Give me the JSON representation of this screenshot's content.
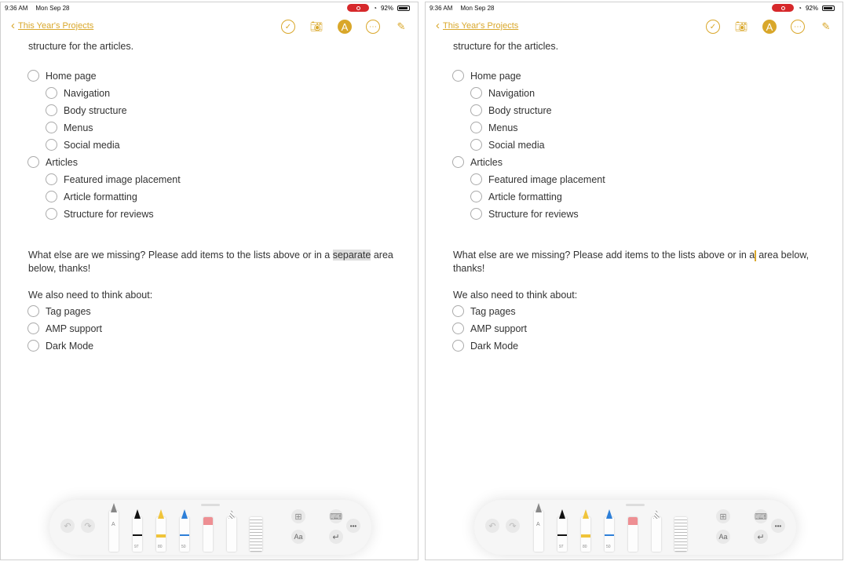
{
  "status": {
    "time": "9:36 AM",
    "date": "Mon Sep 28",
    "battery": "92%"
  },
  "nav": {
    "back_label": "This Year's Projects"
  },
  "header_icons": [
    "checklist-icon",
    "camera-icon",
    "markup-icon",
    "more-icon",
    "compose-icon"
  ],
  "note": {
    "intro": "structure for the articles.",
    "lists": [
      {
        "label": "Home page",
        "level": 0
      },
      {
        "label": "Navigation",
        "level": 1
      },
      {
        "label": "Body structure",
        "level": 1
      },
      {
        "label": "Menus",
        "level": 1
      },
      {
        "label": "Social media",
        "level": 1
      },
      {
        "label": "Articles",
        "level": 0
      },
      {
        "label": "Featured image placement",
        "level": 1
      },
      {
        "label": "Article formatting",
        "level": 1
      },
      {
        "label": "Structure for reviews",
        "level": 1
      }
    ],
    "left_paragraph": {
      "before": "What else are we missing? Please add items to the lists above or in a ",
      "selected": "separate",
      "after": " area below, thanks!"
    },
    "right_paragraph": {
      "before": "What else are we missing? Please add items to the lists above or in a",
      "after": " area below, thanks!"
    },
    "also": "We also need to think about:",
    "also_items": [
      "Tag pages",
      "AMP support",
      "Dark Mode"
    ]
  },
  "toolbar": {
    "pen_labels": [
      "A",
      "97",
      "80",
      "50"
    ],
    "format_label": "Aa",
    "more": "•••"
  },
  "colors": {
    "accent": "#d9a72a",
    "recording": "#d6282b"
  }
}
